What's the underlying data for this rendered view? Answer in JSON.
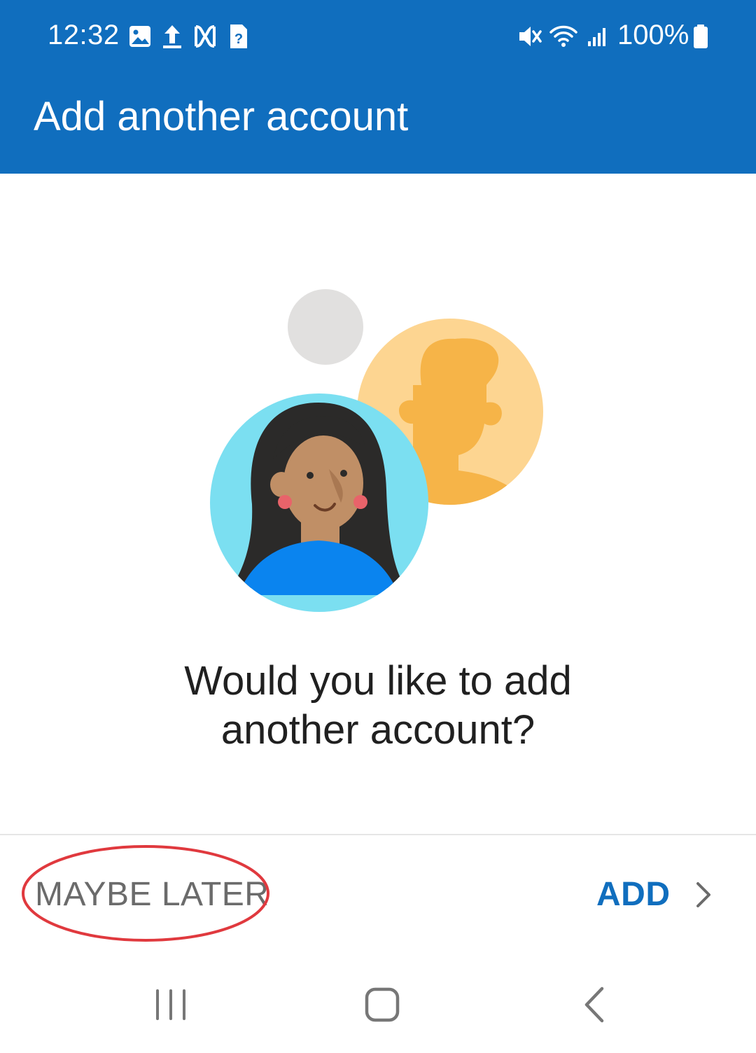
{
  "status_bar": {
    "time": "12:32",
    "notification_icons": [
      "image-icon",
      "upload-icon",
      "link-app-icon",
      "unknown-file-icon"
    ],
    "system_icons": [
      "vibrate-mute-icon",
      "wifi-icon",
      "signal-icon"
    ],
    "battery_text": "100%",
    "battery_icon": "battery-full-icon"
  },
  "app_bar": {
    "title": "Add another account"
  },
  "illustration": {
    "icon_name": "accounts-illustration",
    "colors": {
      "grey_circle": "#e1e0df",
      "back_circle": "#fdd591",
      "back_person": "#f6b448",
      "front_circle": "#7bdff1",
      "hair": "#2b2a29",
      "skin": "#c08f66",
      "earring": "#e8636a",
      "shirt": "#0a84ef"
    }
  },
  "content": {
    "question_line1": "Would you like to add",
    "question_line2": "another account?"
  },
  "actions": {
    "maybe_later_label": "MAYBE LATER",
    "add_label": "ADD",
    "add_icon": "chevron-right-icon"
  },
  "annotation": {
    "shape": "ellipse",
    "target": "maybe-later-button",
    "color": "#e0393e"
  },
  "nav_bar": {
    "recents_icon": "recents-icon",
    "home_icon": "home-icon",
    "back_icon": "back-icon"
  },
  "theme": {
    "header_bg": "#106ebe",
    "accent": "#106ebe",
    "text_primary": "#202020",
    "text_secondary": "#6b6b6b"
  }
}
